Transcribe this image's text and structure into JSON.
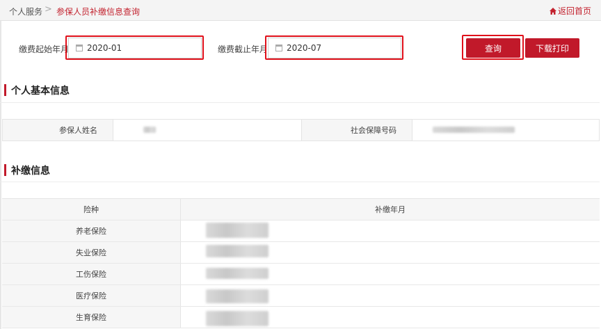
{
  "breadcrumb": {
    "root": "个人服务",
    "separator": ">",
    "current": "参保人员补缴信息查询"
  },
  "home_link": {
    "label": "返回首页",
    "icon": "home-icon"
  },
  "filters": {
    "start_label": "缴费起始年月",
    "start_value": "2020-01",
    "end_label": "缴费截止年月",
    "end_value": "2020-07",
    "calendar_icon": "calendar-icon"
  },
  "buttons": {
    "query": "查询",
    "download_print": "下载打印"
  },
  "basic_info": {
    "title": "个人基本信息",
    "name_label": "参保人姓名",
    "ssn_label": "社会保障号码"
  },
  "payment_info": {
    "title": "补缴信息",
    "columns": [
      "险种",
      "补缴年月"
    ],
    "rows": [
      {
        "type": "养老保险"
      },
      {
        "type": "失业保险"
      },
      {
        "type": "工伤保险"
      },
      {
        "type": "医疗保险"
      },
      {
        "type": "生育保险"
      }
    ]
  },
  "colors": {
    "accent": "#c1192a",
    "highlight": "#e0101a"
  }
}
